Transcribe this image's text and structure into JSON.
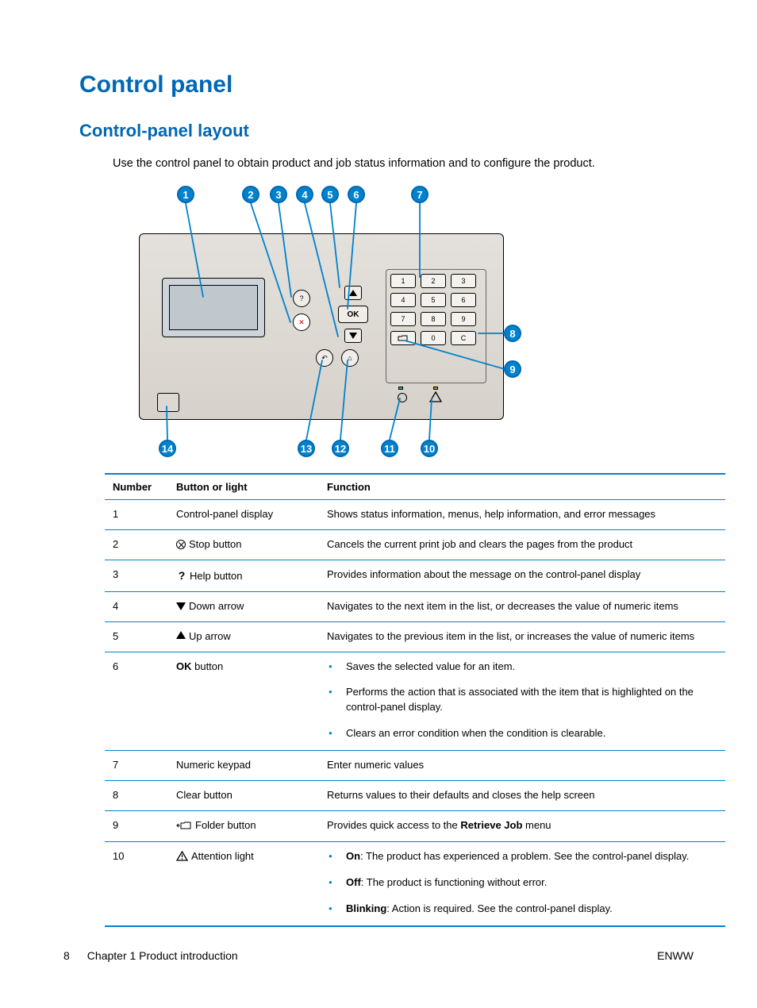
{
  "heading": "Control panel",
  "subheading": "Control-panel layout",
  "intro": "Use the control panel to obtain product and job status information and to configure the product.",
  "callouts_top": [
    "1",
    "2",
    "3",
    "4",
    "5",
    "6",
    "7"
  ],
  "callouts_right": [
    "8",
    "9"
  ],
  "callouts_bottom": [
    "14",
    "13",
    "12",
    "11",
    "10"
  ],
  "ok_label": "OK",
  "keypad": [
    [
      "1",
      "2",
      "3"
    ],
    [
      "4",
      "5",
      "6"
    ],
    [
      "7",
      "8",
      "9"
    ],
    [
      "",
      "0",
      "C"
    ]
  ],
  "table": {
    "headers": [
      "Number",
      "Button or light",
      "Function"
    ],
    "rows": [
      {
        "num": "1",
        "btn": "Control-panel display",
        "func": "Shows status information, menus, help information, and error messages"
      },
      {
        "num": "2",
        "icon": "stop",
        "btn": "Stop button",
        "func": "Cancels the current print job and clears the pages from the product"
      },
      {
        "num": "3",
        "icon": "help",
        "btn": "Help button",
        "func": "Provides information about the message on the control-panel display"
      },
      {
        "num": "4",
        "icon": "down",
        "btn": "Down arrow",
        "func": "Navigates to the next item in the list, or decreases the value of numeric items"
      },
      {
        "num": "5",
        "icon": "up",
        "btn": "Up arrow",
        "func": "Navigates to the previous item in the list, or increases the value of numeric items"
      },
      {
        "num": "6",
        "btn_bold": "OK",
        "btn_suffix": " button",
        "list": [
          "Saves the selected value for an item.",
          "Performs the action that is associated with the item that is highlighted on the control-panel display.",
          "Clears an error condition when the condition is clearable."
        ]
      },
      {
        "num": "7",
        "btn": "Numeric keypad",
        "func": "Enter numeric values"
      },
      {
        "num": "8",
        "btn": "Clear button",
        "func": "Returns values to their defaults and closes the help screen"
      },
      {
        "num": "9",
        "icon": "folder",
        "btn": "Folder button",
        "func_pre": "Provides quick access to the ",
        "func_bold": "Retrieve Job",
        "func_post": " menu"
      },
      {
        "num": "10",
        "icon": "attention",
        "btn": "Attention light",
        "list_kv": [
          {
            "k": "On",
            "v": ": The product has experienced a problem. See the control-panel display."
          },
          {
            "k": "Off",
            "v": ": The product is functioning without error."
          },
          {
            "k": "Blinking",
            "v": ": Action is required. See the control-panel display."
          }
        ]
      }
    ]
  },
  "footer": {
    "page": "8",
    "chapter": "Chapter 1   Product introduction",
    "lang": "ENWW"
  }
}
